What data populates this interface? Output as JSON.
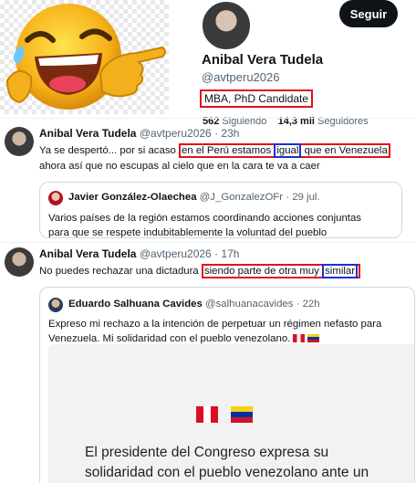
{
  "profile": {
    "name": "Anibal Vera Tudela",
    "handle": "@avtperu2026",
    "follow_label": "Seguir",
    "bio": "MBA, PhD Candidate",
    "following_count": "562",
    "following_label": "Siguiendo",
    "followers_count": "14,3 mil",
    "followers_label": "Seguidores"
  },
  "tweets": [
    {
      "name": "Anibal Vera Tudela",
      "handle": "@avtperu2026",
      "sep": "·",
      "time": "23h",
      "text_pre": "Ya se despertó... por si acaso ",
      "text_hl_a": "en el Perú estamos ",
      "text_hl_blue": "igual",
      "text_hl_b": " que en Venezuela",
      "text_line2": "ahora así que no escupas al cielo que en la cara te va a caer",
      "quote": {
        "name": "Javier González-Olaechea",
        "handle": "@J_GonzalezOFr",
        "sep": "·",
        "time": "29 jul.",
        "line1": "Varios países de la región estamos coordinando acciones conjuntas",
        "line2": "para que se respete indubitablemente  la voluntad del pueblo"
      }
    },
    {
      "name": "Anibal Vera Tudela",
      "handle": "@avtperu2026",
      "sep": "·",
      "time": "17h",
      "text_pre": "No puedes rechazar una dictadura ",
      "text_hl_a": "siendo parte de otra muy ",
      "text_hl_blue": "similar",
      "quote": {
        "name": "Eduardo Salhuana Cavides",
        "handle": "@salhuanacavides",
        "sep": "·",
        "time": "22h",
        "line1": "Expreso mi rechazo a la intención de perpetuar un régimen nefasto para",
        "line2": "Venezuela. Mi solidaridad con el pueblo venezolano.",
        "media_line1": "El  presidente  del  Congreso  expresa  su",
        "media_line2": "solidaridad con el pueblo venezolano ante un"
      }
    }
  ],
  "icons": [
    "laughing-pointing-emoji",
    "flag-peru",
    "flag-venezuela"
  ]
}
